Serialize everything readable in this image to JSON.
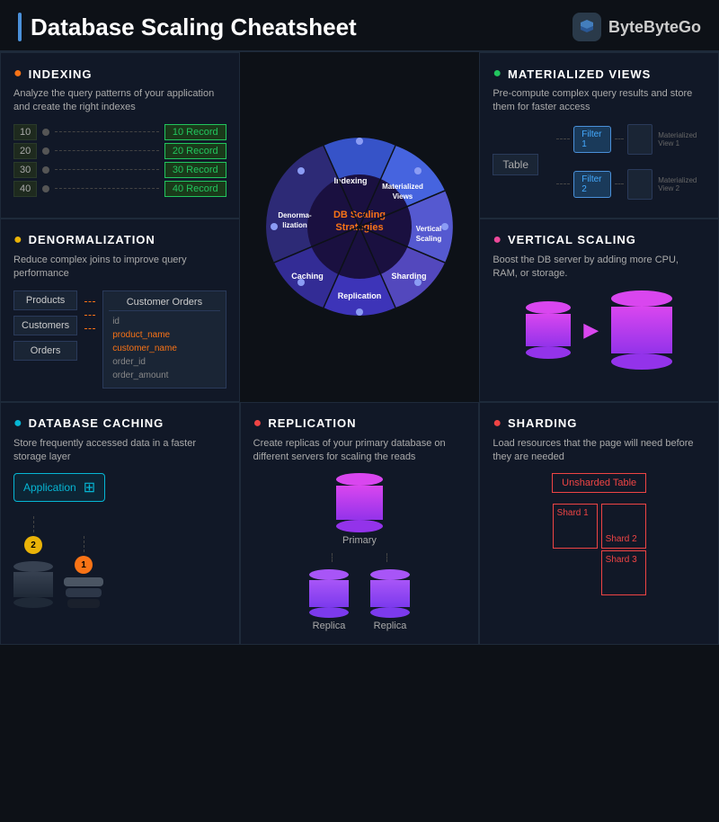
{
  "header": {
    "title": "Database Scaling Cheatsheet",
    "logo_name": "ByteByteGo"
  },
  "indexing": {
    "title": "INDEXING",
    "description": "Analyze the query patterns of your application and create the right indexes",
    "rows": [
      {
        "num": "10",
        "record": "Record"
      },
      {
        "num": "20",
        "record": "Record"
      },
      {
        "num": "30",
        "record": "Record"
      },
      {
        "num": "40",
        "record": "Record"
      }
    ]
  },
  "matviews": {
    "title": "MATERIALIZED VIEWS",
    "description": "Pre-compute complex query results and store them for faster access",
    "table_label": "Table",
    "filter1": "Filter 1",
    "filter2": "Filter 2",
    "view1_label": "Materialized View 1",
    "view2_label": "Materialized View 2"
  },
  "denorm": {
    "title": "DENORMALIZATION",
    "description": "Reduce complex joins to improve query performance",
    "entities": [
      "Products",
      "Customers",
      "Orders"
    ],
    "merged_title": "Customer Orders",
    "fields": [
      "id",
      "product_name",
      "customer_name",
      "order_id",
      "order_amount"
    ]
  },
  "vscale": {
    "title": "VERTICAL SCALING",
    "description": "Boost the DB server by adding more CPU, RAM, or storage."
  },
  "wheel": {
    "center_label": "DB Scaling Strategies",
    "segments": [
      "Indexing",
      "Materialized Views",
      "Vertical Scaling",
      "Sharding",
      "Replication",
      "Caching",
      "Denorma-lization"
    ]
  },
  "caching": {
    "title": "DATABASE CACHING",
    "description": "Store frequently accessed data in a faster storage layer",
    "app_label": "Application",
    "num1": "1",
    "num2": "2"
  },
  "replication": {
    "title": "REPLICATION",
    "description": "Create replicas of your primary database on different servers for scaling the reads",
    "primary_label": "Primary",
    "replica1_label": "Replica",
    "replica2_label": "Replica"
  },
  "sharding": {
    "title": "SHARDING",
    "description": "Load resources that the page will need before they are needed",
    "unsharded_label": "Unsharded Table",
    "shard1_label": "Shard 1",
    "shard2_label": "Shard 2",
    "shard3_label": "Shard 3"
  },
  "colors": {
    "orange": "#f97316",
    "green": "#22c55e",
    "yellow": "#eab308",
    "cyan": "#06b6d4",
    "red": "#ef4444",
    "pink": "#ec4899",
    "purple": "#a855f7",
    "blue": "#3b82f6"
  }
}
